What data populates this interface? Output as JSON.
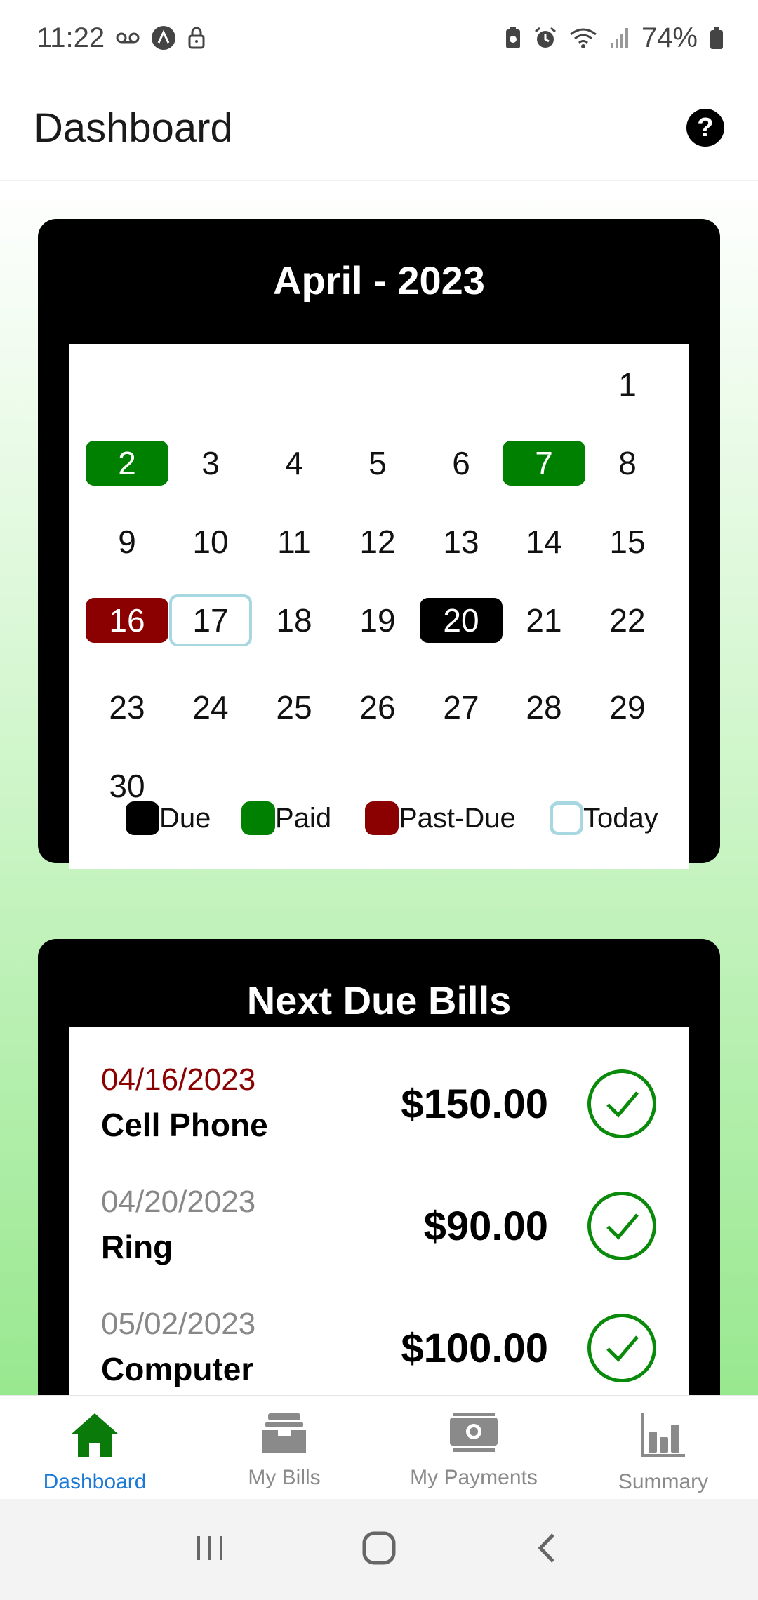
{
  "status_bar": {
    "time": "11:22",
    "battery": "74%",
    "icons_left": [
      "voicemail-icon",
      "app-icon",
      "lock-icon"
    ],
    "icons_right": [
      "battery-saver-icon",
      "alarm-icon",
      "wifi-icon",
      "signal-icon",
      "battery-icon"
    ]
  },
  "header": {
    "title": "Dashboard",
    "help_label": "?"
  },
  "calendar": {
    "title": "April - 2023",
    "days": [
      {
        "day": "1",
        "status": "normal"
      },
      {
        "day": "2",
        "status": "paid"
      },
      {
        "day": "3",
        "status": "normal"
      },
      {
        "day": "4",
        "status": "normal"
      },
      {
        "day": "5",
        "status": "normal"
      },
      {
        "day": "6",
        "status": "normal"
      },
      {
        "day": "7",
        "status": "paid"
      },
      {
        "day": "8",
        "status": "normal"
      },
      {
        "day": "9",
        "status": "normal"
      },
      {
        "day": "10",
        "status": "normal"
      },
      {
        "day": "11",
        "status": "normal"
      },
      {
        "day": "12",
        "status": "normal"
      },
      {
        "day": "13",
        "status": "normal"
      },
      {
        "day": "14",
        "status": "normal"
      },
      {
        "day": "15",
        "status": "normal"
      },
      {
        "day": "16",
        "status": "pastdue"
      },
      {
        "day": "17",
        "status": "today"
      },
      {
        "day": "18",
        "status": "normal"
      },
      {
        "day": "19",
        "status": "normal"
      },
      {
        "day": "20",
        "status": "due"
      },
      {
        "day": "21",
        "status": "normal"
      },
      {
        "day": "22",
        "status": "normal"
      },
      {
        "day": "23",
        "status": "normal"
      },
      {
        "day": "24",
        "status": "normal"
      },
      {
        "day": "25",
        "status": "normal"
      },
      {
        "day": "26",
        "status": "normal"
      },
      {
        "day": "27",
        "status": "normal"
      },
      {
        "day": "28",
        "status": "normal"
      },
      {
        "day": "29",
        "status": "normal"
      },
      {
        "day": "30",
        "status": "normal"
      }
    ],
    "legend": [
      {
        "label": "Due",
        "color": "#000000"
      },
      {
        "label": "Paid",
        "color": "#008000"
      },
      {
        "label": "Past-Due",
        "color": "#8b0000"
      },
      {
        "label": "Today",
        "color": "#a7d7e0"
      }
    ]
  },
  "next_due": {
    "title": "Next Due Bills",
    "bills": [
      {
        "date": "04/16/2023",
        "name": "Cell Phone",
        "amount": "$150.00",
        "overdue": true
      },
      {
        "date": "04/20/2023",
        "name": "Ring",
        "amount": "$90.00",
        "overdue": false
      },
      {
        "date": "05/02/2023",
        "name": "Computer",
        "amount": "$100.00",
        "overdue": false
      }
    ]
  },
  "bottom_nav": {
    "items": [
      {
        "label": "Dashboard",
        "icon": "home-icon",
        "active": true
      },
      {
        "label": "My Bills",
        "icon": "inbox-icon",
        "active": false
      },
      {
        "label": "My Payments",
        "icon": "money-icon",
        "active": false
      },
      {
        "label": "Summary",
        "icon": "bar-chart-icon",
        "active": false
      }
    ]
  },
  "colors": {
    "paid": "#008000",
    "pastdue": "#8b0000",
    "due": "#000000",
    "today": "#a7d7e0",
    "active_nav": "#1c7ad6",
    "active_icon": "#0a7a0a"
  }
}
